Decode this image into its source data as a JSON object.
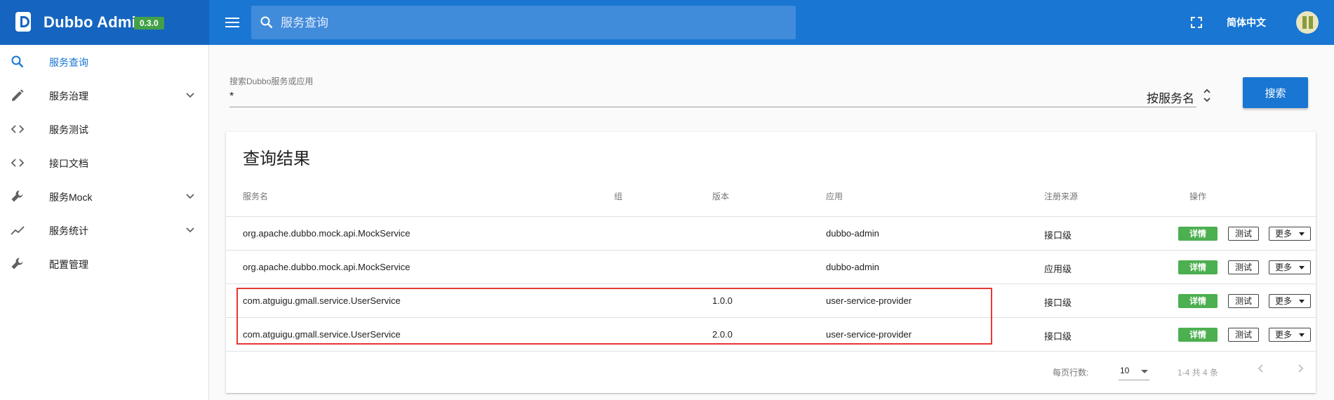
{
  "brand": {
    "name": "Dubbo Admin",
    "version": "0.3.0"
  },
  "topbar": {
    "search_placeholder": "服务查询",
    "language": "简体中文"
  },
  "sidebar": {
    "items": [
      {
        "label": "服务查询",
        "icon": "search-icon",
        "active": true
      },
      {
        "label": "服务治理",
        "icon": "pencil-icon",
        "expandable": true
      },
      {
        "label": "服务测试",
        "icon": "code-icon"
      },
      {
        "label": "接口文档",
        "icon": "code-icon"
      },
      {
        "label": "服务Mock",
        "icon": "wrench-icon",
        "expandable": true
      },
      {
        "label": "服务统计",
        "icon": "trending-icon",
        "expandable": true
      },
      {
        "label": "配置管理",
        "icon": "wrench-icon"
      }
    ]
  },
  "search_form": {
    "label": "搜索Dubbo服务或应用",
    "value": "*",
    "type_selected": "按服务名",
    "submit": "搜索"
  },
  "results": {
    "title": "查询结果",
    "columns": [
      "服务名",
      "组",
      "版本",
      "应用",
      "注册来源",
      "操作"
    ],
    "rows": [
      {
        "service": "org.apache.dubbo.mock.api.MockService",
        "group": "",
        "version": "",
        "app": "dubbo-admin",
        "source": "接口级"
      },
      {
        "service": "org.apache.dubbo.mock.api.MockService",
        "group": "",
        "version": "",
        "app": "dubbo-admin",
        "source": "应用级"
      },
      {
        "service": "com.atguigu.gmall.service.UserService",
        "group": "",
        "version": "1.0.0",
        "app": "user-service-provider",
        "source": "接口级"
      },
      {
        "service": "com.atguigu.gmall.service.UserService",
        "group": "",
        "version": "2.0.0",
        "app": "user-service-provider",
        "source": "接口级"
      }
    ],
    "actions": {
      "detail": "详情",
      "test": "测试",
      "more": "更多"
    },
    "pagination": {
      "rows_per_page_label": "每页行数:",
      "rows_per_page": "10",
      "range": "1-4 共 4 条"
    }
  },
  "colors": {
    "primary": "#1976d2",
    "brand_dark": "#1565c0",
    "success": "#4caf50",
    "highlight": "#e53935"
  }
}
